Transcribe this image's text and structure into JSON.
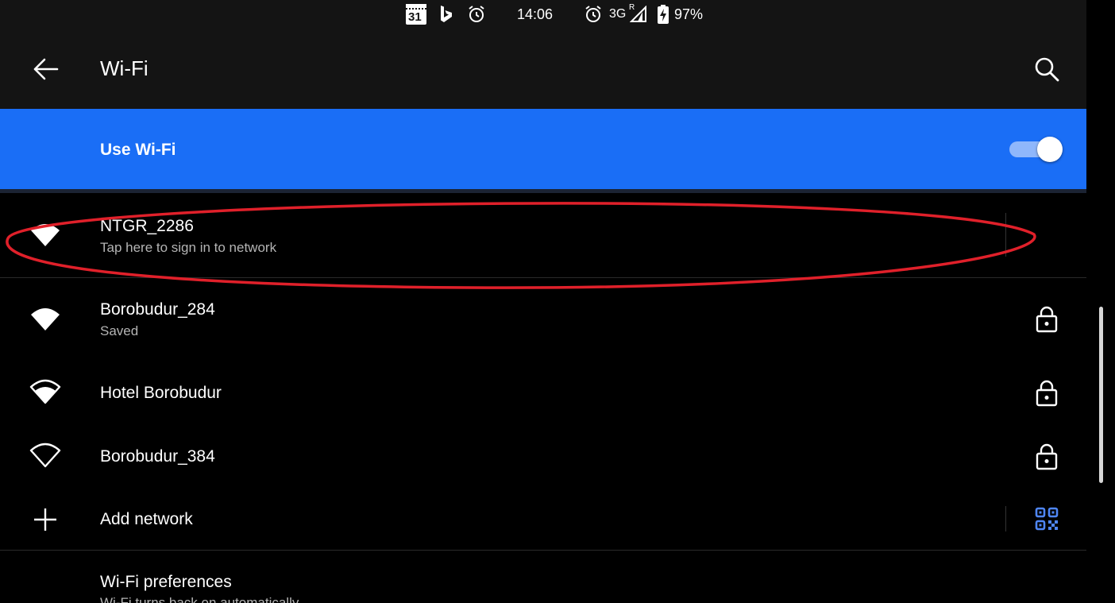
{
  "status_bar": {
    "calendar_day": "31",
    "time": "14:06",
    "network": "3G",
    "roaming": "R",
    "battery": "97%"
  },
  "header": {
    "title": "Wi-Fi"
  },
  "master_toggle": {
    "label": "Use Wi-Fi",
    "enabled": true
  },
  "networks": [
    {
      "name": "NTGR_2286",
      "status": "Tap here to sign in to network",
      "signal": "wifi-full-icon",
      "secured": false
    },
    {
      "name": "Borobudur_284",
      "status": "Saved",
      "signal": "wifi-full-icon",
      "secured": true
    },
    {
      "name": "Hotel Borobudur",
      "status": "",
      "signal": "wifi-high-icon",
      "secured": true
    },
    {
      "name": "Borobudur_384",
      "status": "",
      "signal": "wifi-empty-icon",
      "secured": true
    }
  ],
  "add_network": {
    "label": "Add network"
  },
  "preferences": {
    "title": "Wi-Fi preferences",
    "subtitle": "Wi-Fi turns back on automatically"
  },
  "colors": {
    "accent": "#1a6ef6",
    "annotation": "#e0202a",
    "qr_icon": "#4f86f5"
  }
}
